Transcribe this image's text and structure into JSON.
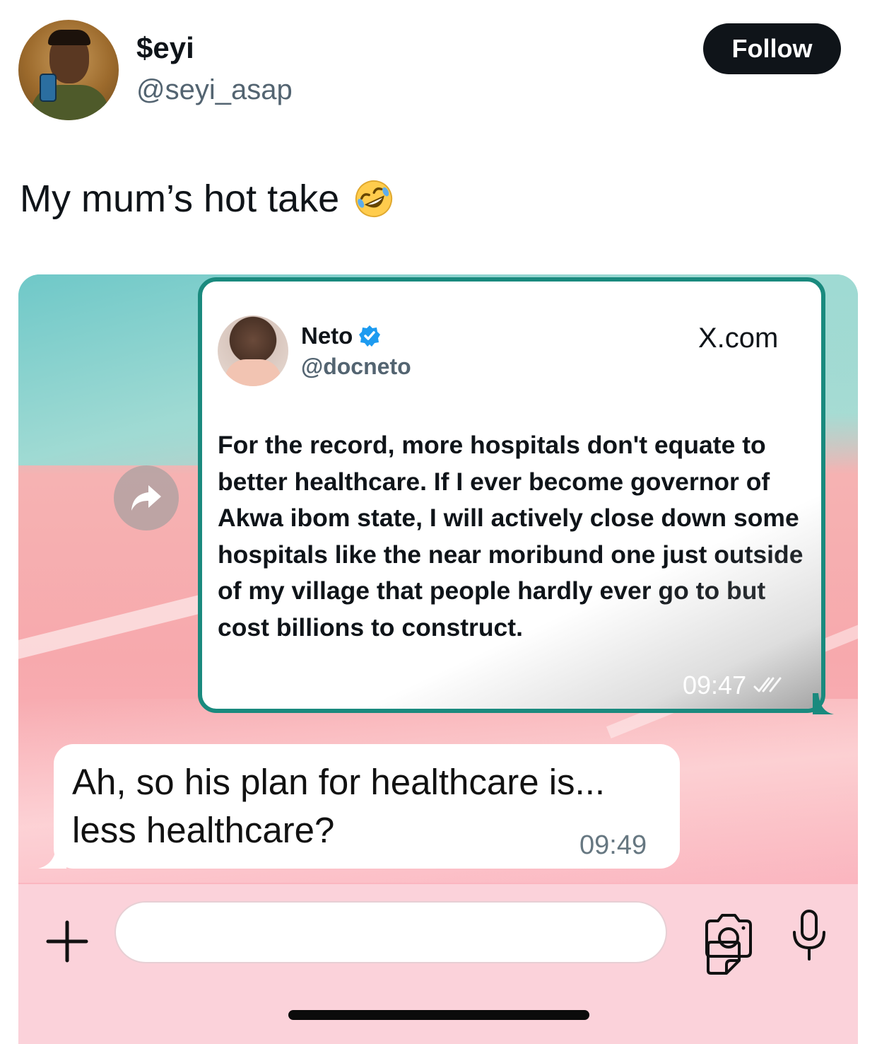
{
  "author": {
    "display_name": "$eyi",
    "handle": "@seyi_asap",
    "follow_label": "Follow"
  },
  "tweet": {
    "text": "My mum’s hot take",
    "emoji": "rolling-on-floor-laughing-emoji"
  },
  "screenshot": {
    "quoted_post": {
      "name": "Neto",
      "handle": "@docneto",
      "site": "X.com",
      "body": "For the record, more hospitals don't equate to better healthcare. If I ever become governor of Akwa ibom state, I will actively close down some hospitals like the near moribund one just outside of my village that people hardly ever go to but cost billions to construct.",
      "time": "09:47",
      "verified": true
    },
    "reply": {
      "text_line1": "Ah, so his plan for healthcare is...",
      "text_line2": "less healthcare?",
      "time": "09:49"
    },
    "colors": {
      "bubble_border": "#1a8a7e",
      "input_bar": "#fbd2da",
      "verified_badge": "#1d9bf0"
    }
  }
}
